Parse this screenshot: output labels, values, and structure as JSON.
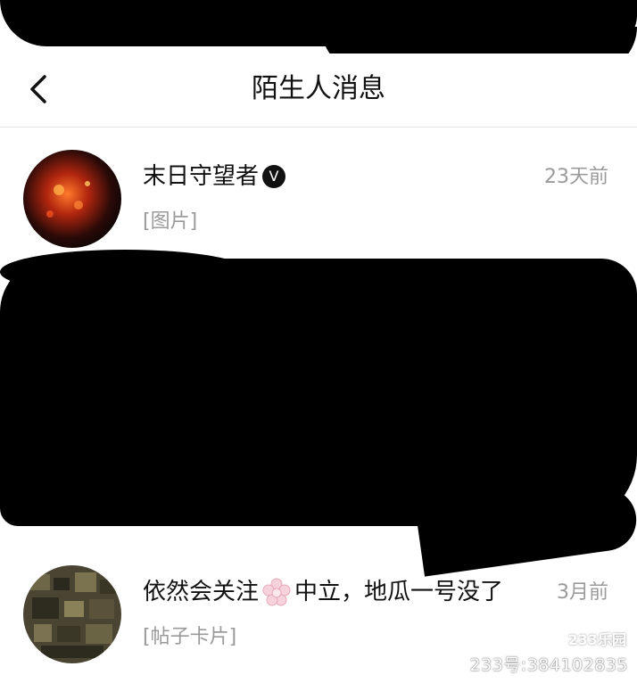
{
  "header": {
    "title": "陌生人消息"
  },
  "conversations": [
    {
      "name": "末日守望者",
      "badge": "V",
      "time": "23天前",
      "preview": "[图片]"
    },
    {
      "name_part1": "依然会关注",
      "name_part2": "中立，地瓜一号没了",
      "time": "3月前",
      "preview": "[帖子卡片]"
    }
  ],
  "watermark": {
    "logo": "233乐园",
    "text": "233号:384102835"
  },
  "colors": {
    "text": "#111111",
    "secondary": "#9a9a9a",
    "divider": "#e6e6e6"
  }
}
